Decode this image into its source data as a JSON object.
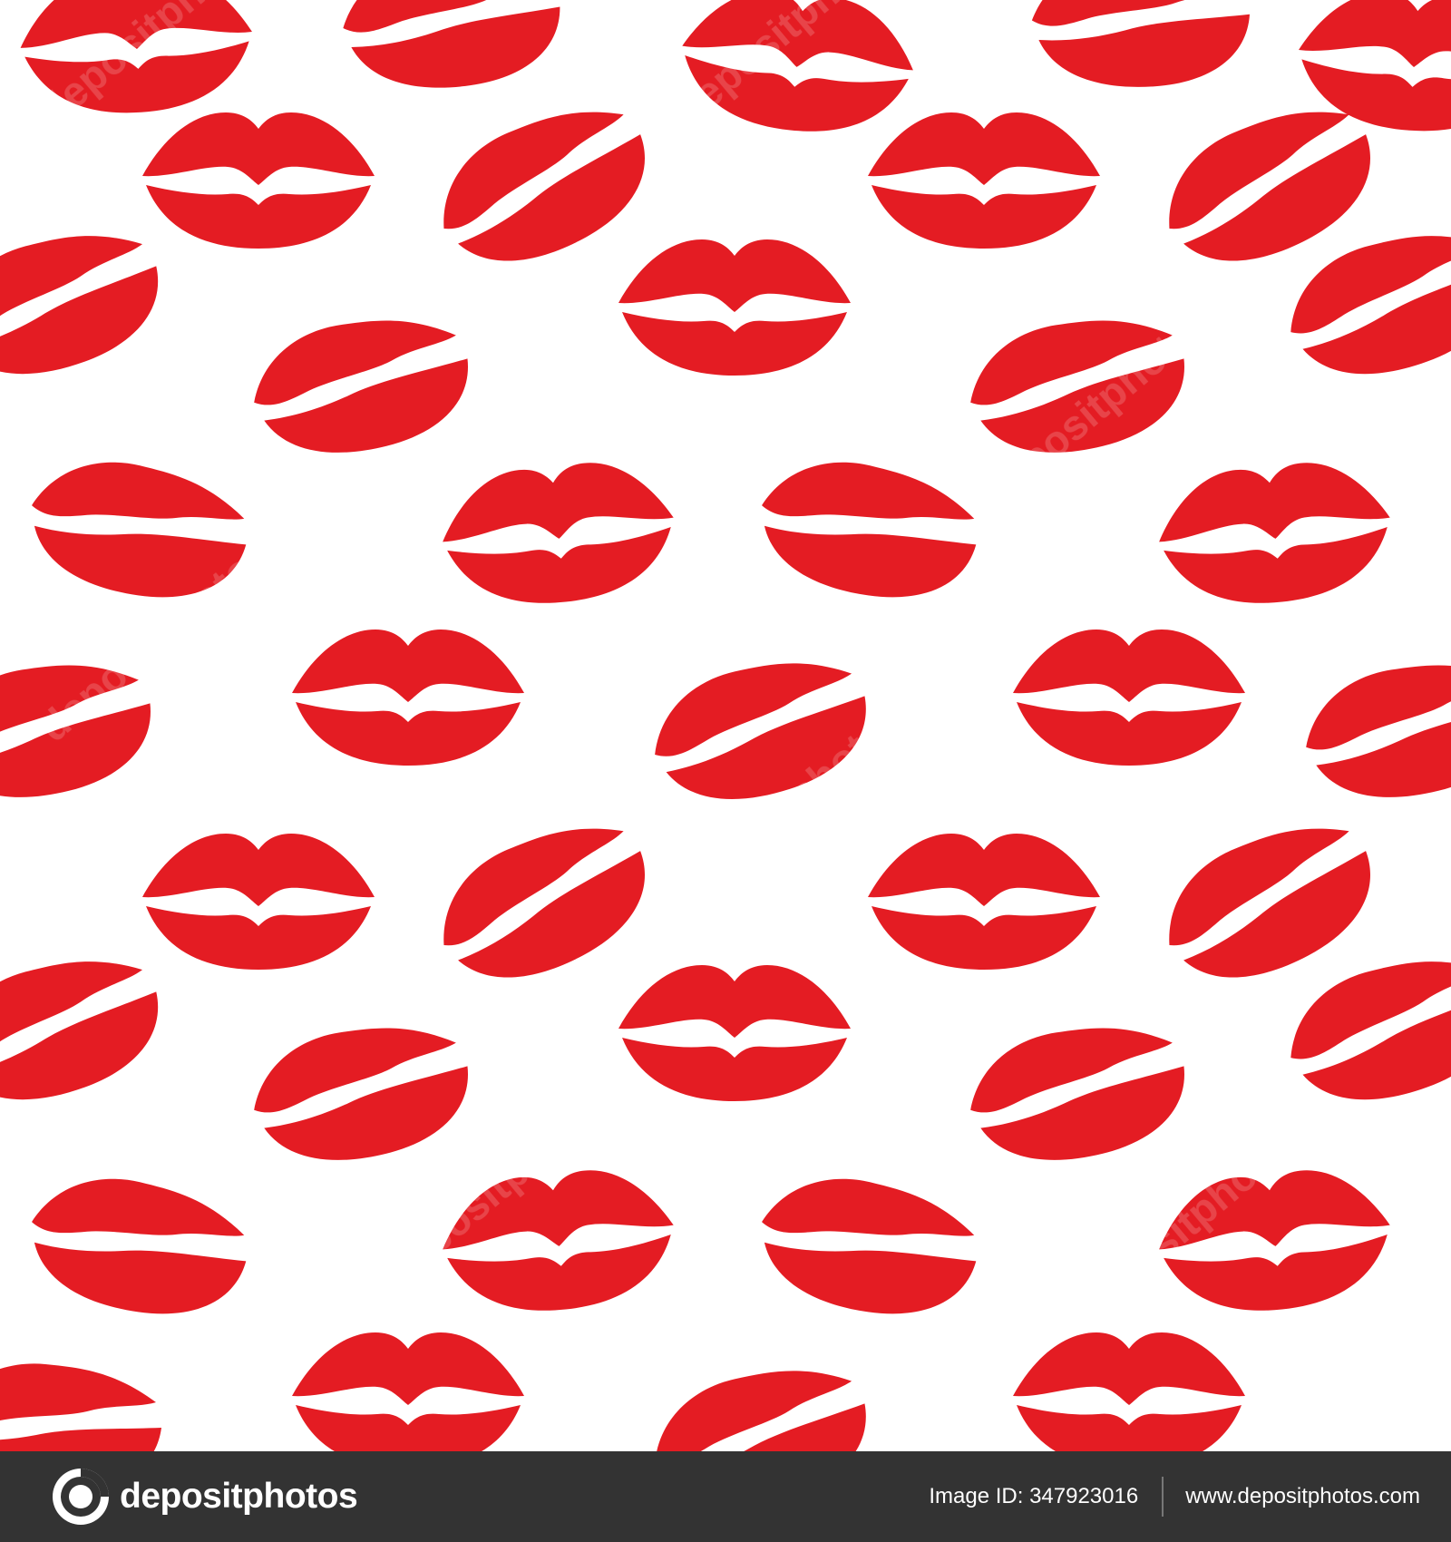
{
  "pattern": {
    "motif": "lipstick-kiss-print",
    "lip_color": "#e41c23",
    "background_color": "#ffffff"
  },
  "footer": {
    "brand_name": "depositphotos",
    "image_id_label": "Image ID:",
    "image_id": "347923016",
    "site_url": "www.depositphotos.com",
    "background_color": "#333333"
  }
}
